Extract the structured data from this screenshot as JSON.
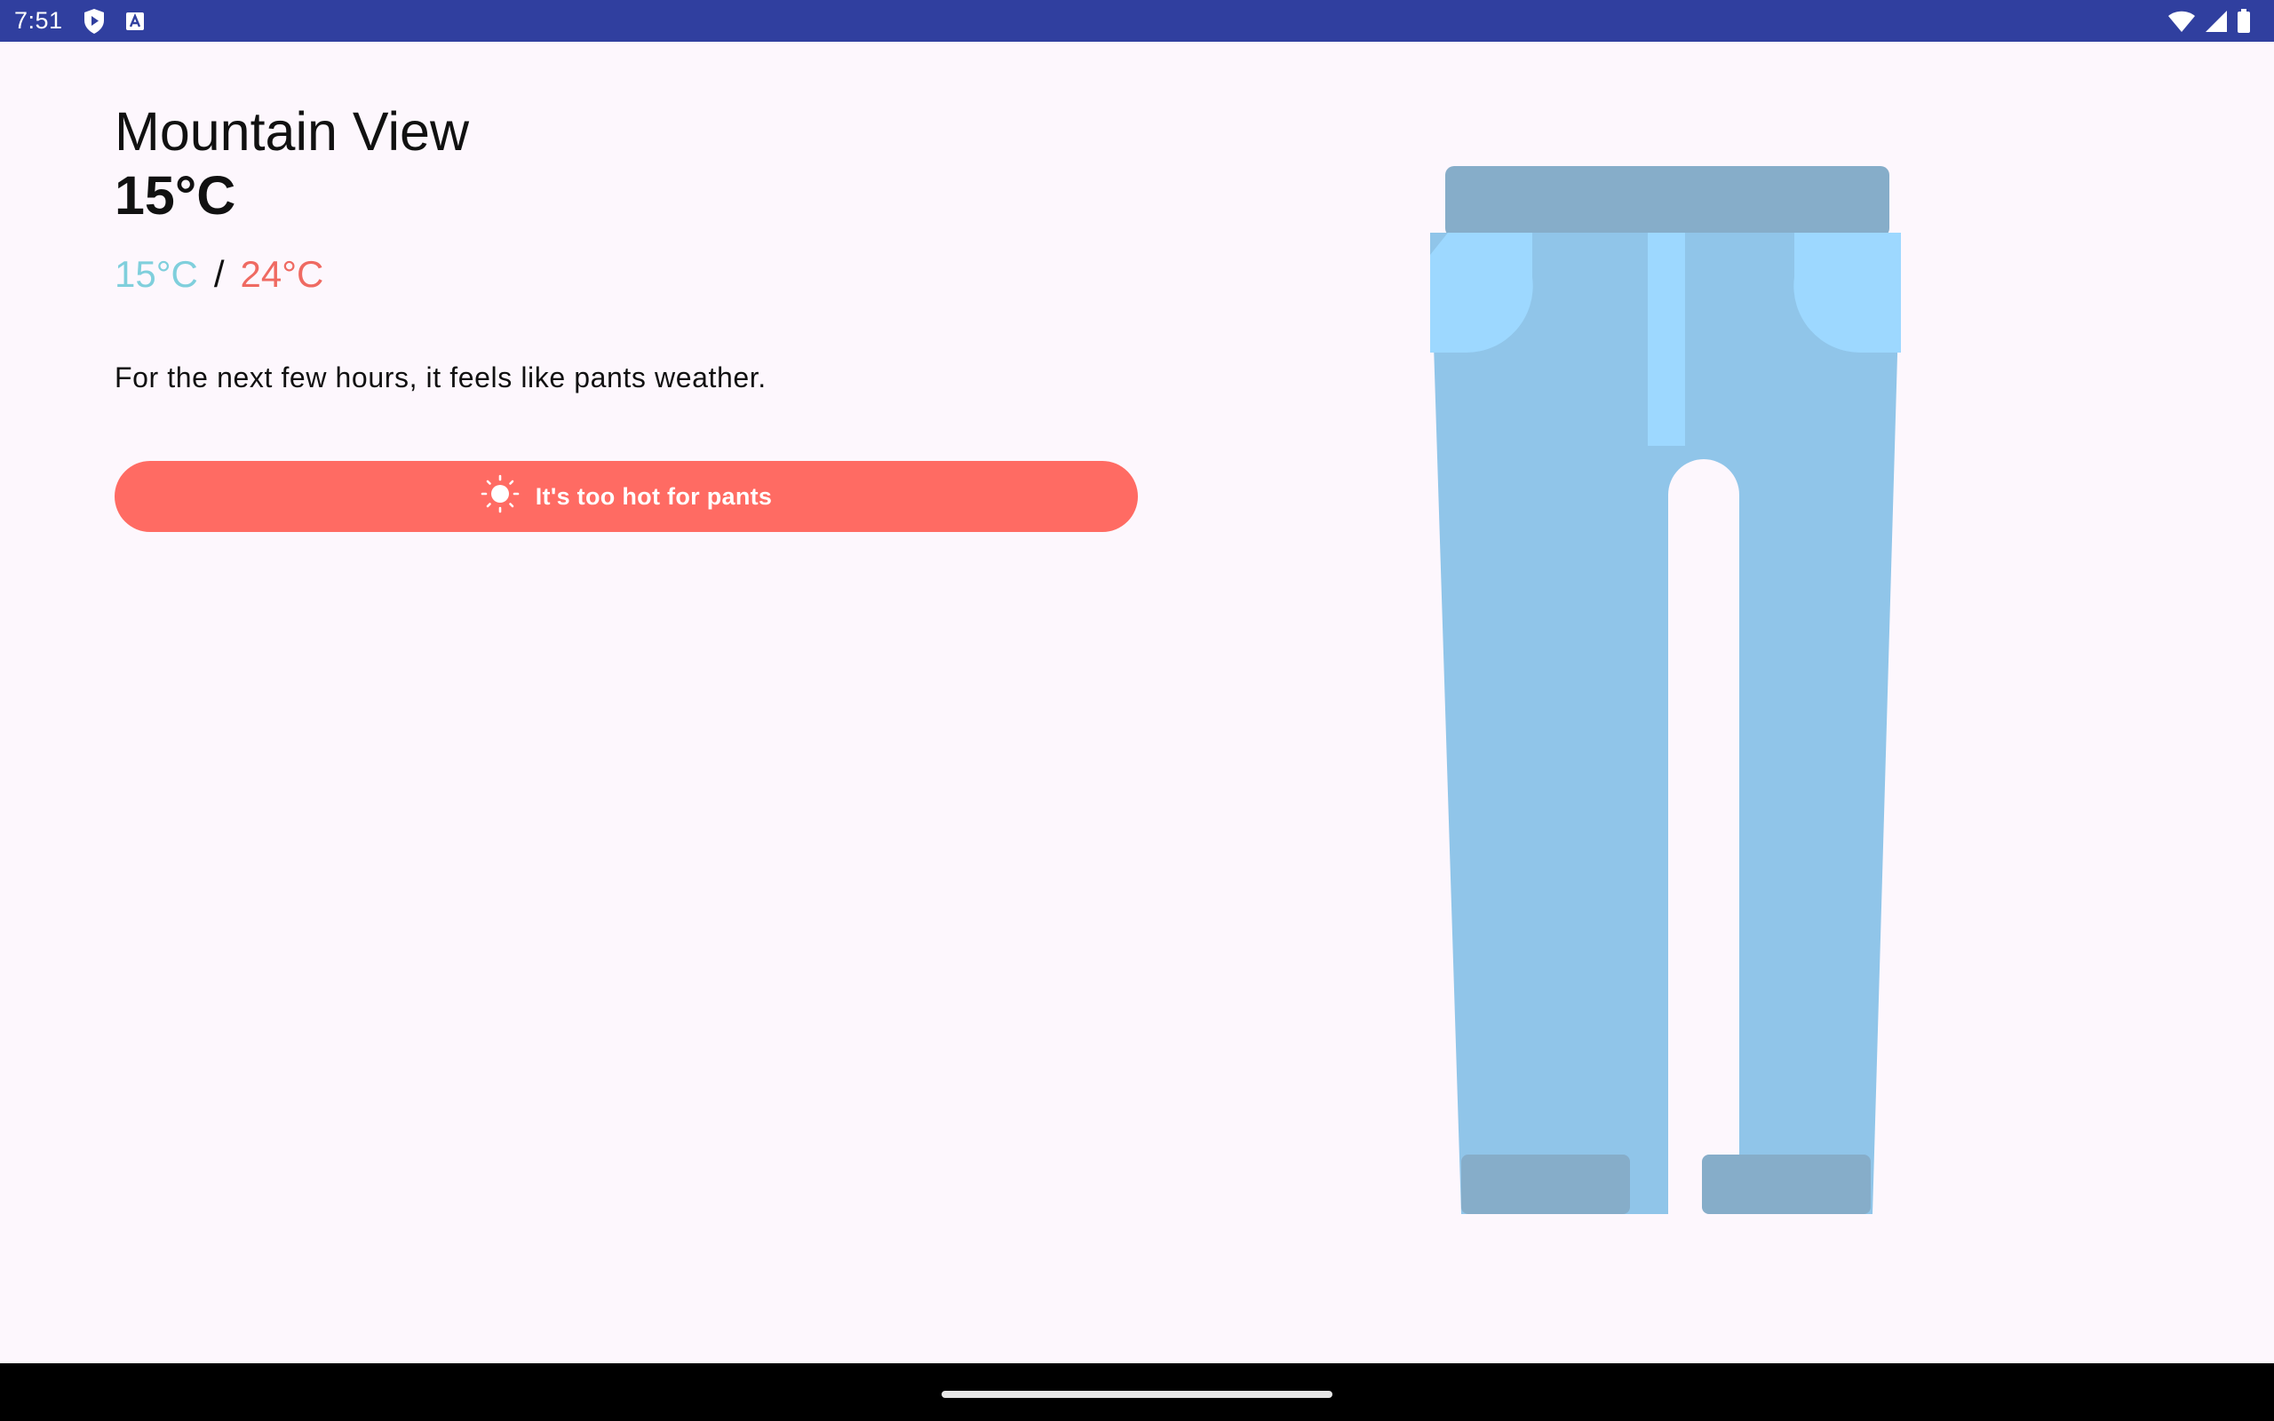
{
  "status_bar": {
    "time": "7:51",
    "icons": [
      "shield-play-icon",
      "a-badge-icon",
      "wifi-icon",
      "signal-icon",
      "battery-icon"
    ],
    "background": "#303f9f"
  },
  "weather": {
    "city": "Mountain View",
    "current_temp": "15°C",
    "low_temp": "15°C",
    "separator": "/",
    "high_temp": "24°C",
    "description": "For the next few hours, it feels like pants weather.",
    "colors": {
      "low": "#7fcfdc",
      "high": "#ef6a62",
      "background": "#fdf7fd"
    }
  },
  "action_button": {
    "label": "It's too hot for pants",
    "icon": "sun-icon",
    "color": "#ff6b63"
  },
  "illustration": {
    "name": "pants-illustration",
    "colors": {
      "body": "#90c5e9",
      "waistband": "#86adc9",
      "pockets": "#9dd8ff",
      "cuffs": "#86adc9"
    }
  },
  "navigation_bar": {
    "handle": "gesture-handle"
  }
}
